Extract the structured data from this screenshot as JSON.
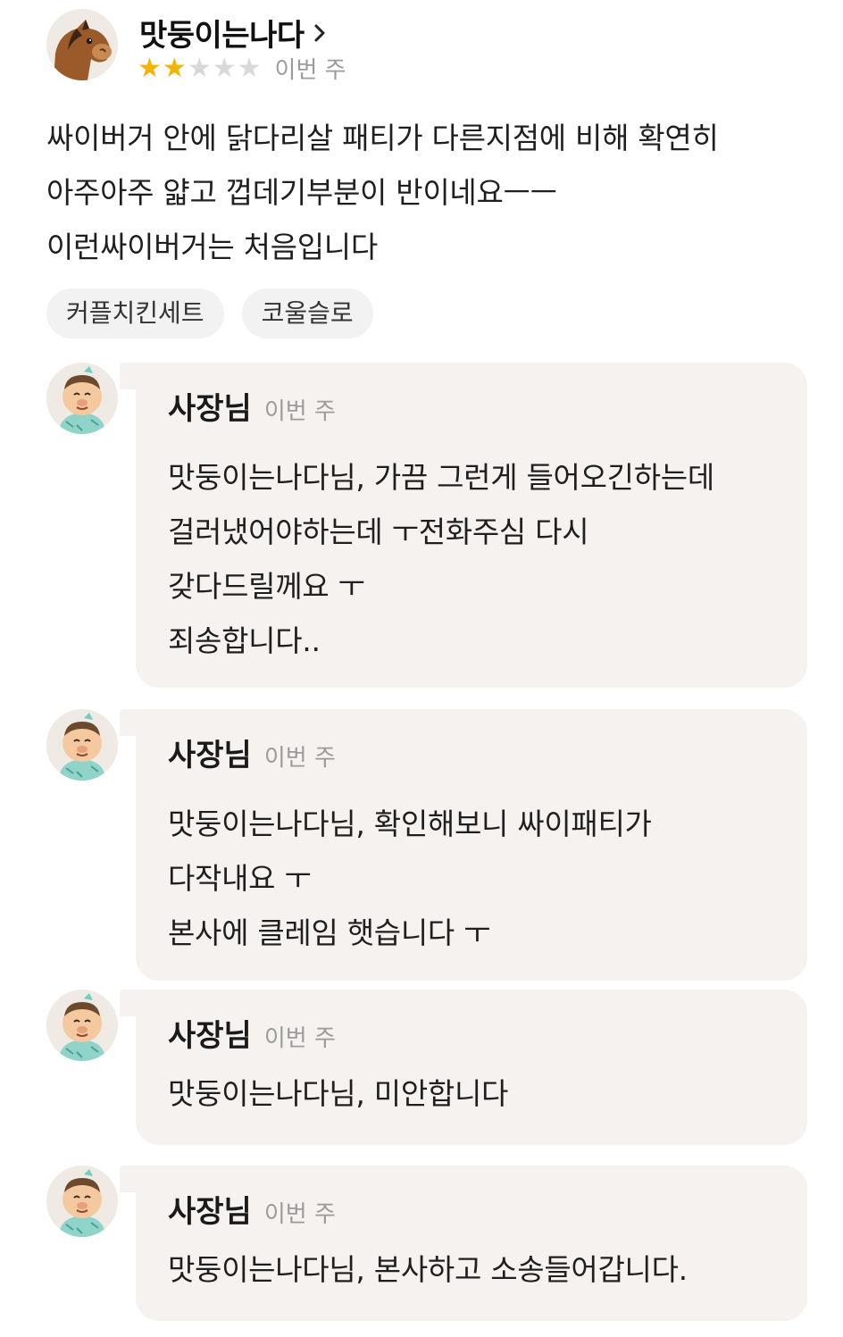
{
  "review": {
    "nickname": "맛둥이는나다",
    "rating": 2,
    "rating_max": 5,
    "date": "이번 주",
    "body_lines": [
      "싸이버거 안에 닭다리살 패티가 다른지점에 비해 확연히",
      "아주아주 얇고 껍데기부분이 반이네요ㅡㅡ",
      "이런싸이버거는 처음입니다"
    ],
    "tags": [
      "커플치킨세트",
      "코울슬로"
    ]
  },
  "replies": [
    {
      "name": "사장님",
      "date": "이번 주",
      "lines": [
        "맛둥이는나다님, 가끔 그런게 들어오긴하는데",
        "걸러냈어야하는데 ㅜ전화주심 다시",
        "갖다드릴께요 ㅜ",
        "죄송합니다.."
      ]
    },
    {
      "name": "사장님",
      "date": "이번 주",
      "lines": [
        "맛둥이는나다님, 확인해보니 싸이패티가",
        "다작내요 ㅜ",
        "본사에 클레임 햇습니다 ㅜ"
      ]
    },
    {
      "name": "사장님",
      "date": "이번 주",
      "lines": [
        "맛둥이는나다님, 미안합니다"
      ]
    },
    {
      "name": "사장님",
      "date": "이번 주",
      "lines": [
        "맛둥이는나다님, 본사하고 소송들어갑니다."
      ]
    }
  ],
  "icons": {
    "reviewer_avatar": "horse-avatar-icon",
    "owner_avatar": "owner-character-avatar-icon",
    "nickname_chevron": "chevron-right-icon",
    "star": "star-icon"
  },
  "colors": {
    "star_on": "#f5b400",
    "star_off": "#d9d9d9",
    "bubble_bg": "#f5f2ef",
    "tag_bg": "#f2f2f2",
    "meta_text": "#9b9b9b"
  }
}
